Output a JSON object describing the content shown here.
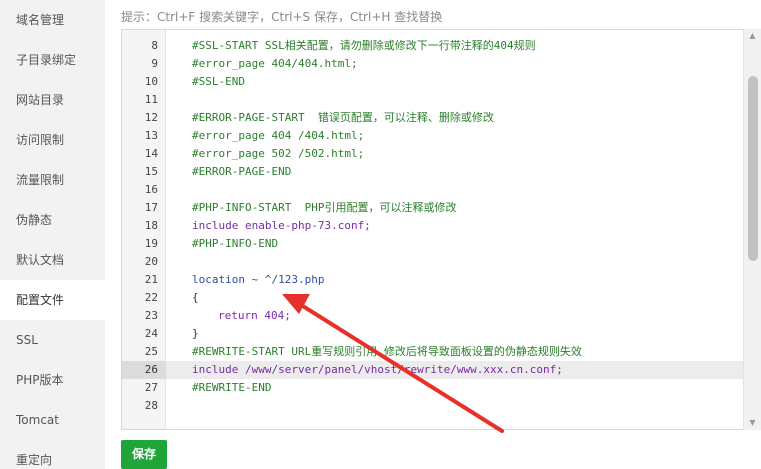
{
  "sidebar": {
    "items": [
      {
        "label": "域名管理"
      },
      {
        "label": "子目录绑定"
      },
      {
        "label": "网站目录"
      },
      {
        "label": "访问限制"
      },
      {
        "label": "流量限制"
      },
      {
        "label": "伪静态"
      },
      {
        "label": "默认文档"
      },
      {
        "label": "配置文件",
        "active": true
      },
      {
        "label": "SSL"
      },
      {
        "label": "PHP版本"
      },
      {
        "label": "Tomcat"
      },
      {
        "label": "重定向"
      }
    ]
  },
  "hint": "提示：Ctrl+F 搜索关键字，Ctrl+S 保存，Ctrl+H 查找替换",
  "editor": {
    "current_line": "26",
    "lines": [
      {
        "num": "8",
        "text": "#SSL-START SSL相关配置，请勿删除或修改下一行带注释的404规则"
      },
      {
        "num": "9",
        "text": "#error_page 404/404.html;"
      },
      {
        "num": "10",
        "text": "#SSL-END"
      },
      {
        "num": "11",
        "text": ""
      },
      {
        "num": "12",
        "text": "#ERROR-PAGE-START  错误页配置，可以注释、删除或修改"
      },
      {
        "num": "13",
        "text": "#error_page 404 /404.html;"
      },
      {
        "num": "14",
        "text": "#error_page 502 /502.html;"
      },
      {
        "num": "15",
        "text": "#ERROR-PAGE-END"
      },
      {
        "num": "16",
        "text": ""
      },
      {
        "num": "17",
        "text": "#PHP-INFO-START  PHP引用配置，可以注释或修改"
      },
      {
        "num": "18",
        "text": "include enable-php-73.conf;"
      },
      {
        "num": "19",
        "text": "#PHP-INFO-END"
      },
      {
        "num": "20",
        "text": ""
      },
      {
        "num": "21",
        "text": "location ~ ^/123.php"
      },
      {
        "num": "22",
        "text": "{"
      },
      {
        "num": "23",
        "text": "return 404;"
      },
      {
        "num": "24",
        "text": "}"
      },
      {
        "num": "25",
        "text": "#REWRITE-START URL重写规则引用,修改后将导致面板设置的伪静态规则失效"
      },
      {
        "num": "26",
        "text": "include /www/server/panel/vhost/rewrite/www.xxx.cn.conf;"
      },
      {
        "num": "27",
        "text": "#REWRITE-END"
      },
      {
        "num": "28",
        "text": ""
      }
    ]
  },
  "save_label": "保存",
  "colors": {
    "accent_green": "#20a53a",
    "comment": "#2b7f2b",
    "keyword": "#7a2aa6",
    "string": "#2d4fa5",
    "annotation_arrow": "#e8302a"
  },
  "icons": [
    "scroll-up-arrow-icon",
    "scroll-down-arrow-icon",
    "annotation-arrow-icon"
  ]
}
